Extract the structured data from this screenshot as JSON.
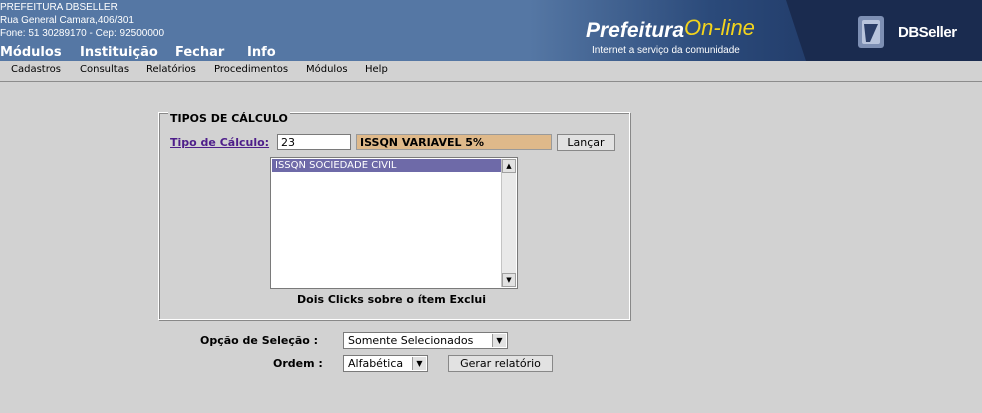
{
  "header": {
    "org_lines": [
      "PREFEITURA DBSELLER",
      "Rua General Camara,406/301",
      "Fone: 51 30289170  -  Cep: 92500000"
    ],
    "top_menu": [
      "Módulos",
      "Instituição",
      "Fechar",
      "Info"
    ],
    "logo_main": "Prefeitura",
    "logo_online": "On-line",
    "logo_sub": "Internet a serviço da comunidade",
    "brand": "DBSeller"
  },
  "submenu": [
    "Cadastros",
    "Consultas",
    "Relatórios",
    "Procedimentos",
    "Módulos",
    "Help"
  ],
  "form": {
    "legend": "TIPOS DE CÁLCULO",
    "tipo_label": "Tipo de Cálculo:",
    "code_value": "23",
    "desc_value": "ISSQN VARIAVEL 5%",
    "lancar_label": "Lançar",
    "list_items": [
      "ISSQN SOCIEDADE CIVIL"
    ],
    "hint": "Dois Clicks sobre o ítem Exclui",
    "opcao_label": "Opção de Seleção :",
    "opcao_value": "Somente Selecionados",
    "ordem_label": "Ordem :",
    "ordem_value": "Alfabética",
    "gerar_label": "Gerar relatório"
  },
  "colors": {
    "header_bg": "#5577a4",
    "page_bg": "#d2d2d2",
    "selected_item": "#6e6aa8",
    "desc_field": "#dfb98a",
    "logo_yellow": "#f3d41c",
    "link_purple": "#4e1e8a"
  },
  "icons": {
    "brand_logo": "dbseller-logo-icon",
    "scroll_up": "arrow-up-icon",
    "scroll_down": "arrow-down-icon",
    "dropdown": "chevron-down-icon"
  }
}
